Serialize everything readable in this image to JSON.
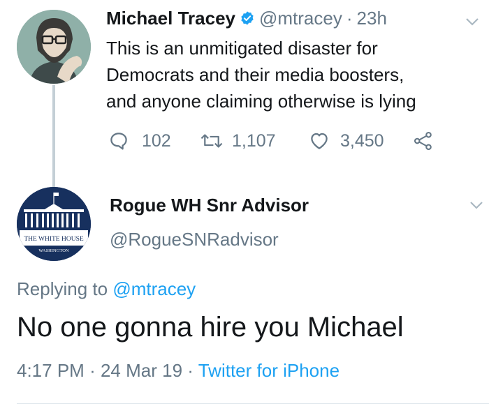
{
  "parent_tweet": {
    "author_name": "Michael Tracey",
    "handle": "@mtracey",
    "separator": "·",
    "time": "23h",
    "text": "This is an unmitigated disaster for Democrats and their media boosters, and anyone claiming otherwise is lying",
    "text_lines": [
      "This is an unmitigated disaster for",
      "Democrats and their media boosters,",
      "and anyone claiming otherwise is lying"
    ],
    "verified": true,
    "actions": {
      "replies": "102",
      "retweets": "1,107",
      "likes": "3,450"
    },
    "icons": [
      "reply-icon",
      "retweet-icon",
      "like-icon",
      "share-icon",
      "chevron-down-icon",
      "verified-icon"
    ]
  },
  "reply_tweet": {
    "author_name": "Rogue WH Snr Advisor",
    "handle": "@RogueSNRadvisor",
    "avatar_text": {
      "line1": "THE WHITE HOUSE",
      "line2": "WASHINGTON"
    },
    "replying_prefix": "Replying to",
    "replying_to": "@mtracey",
    "text": "No one gonna hire you Michael",
    "time": "4:17 PM",
    "date": "24 Mar 19",
    "separator": "·",
    "source": "Twitter for iPhone"
  },
  "colors": {
    "text": "#14171a",
    "secondary": "#657786",
    "accent": "#1da1f2",
    "thread_line": "#c4cfd6",
    "divider": "#e1e8ed"
  }
}
